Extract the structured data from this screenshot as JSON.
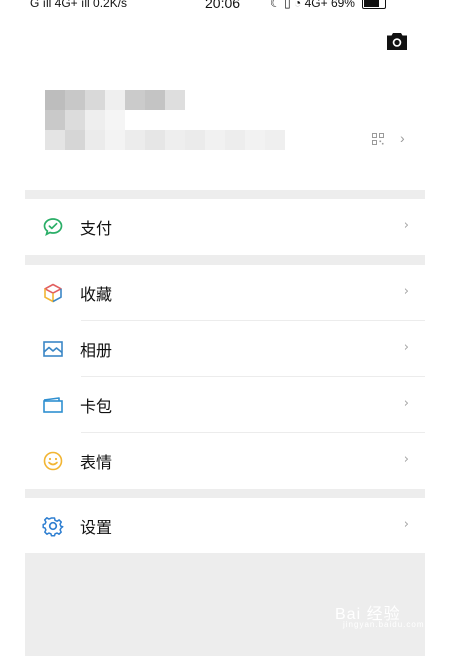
{
  "status_bar": {
    "left": "G ıll 4G+ ıll 0.2K/s",
    "time": "20:06",
    "right": "☾ ▯ ◔ 4G+ 69%"
  },
  "profile": {
    "chevron": "›"
  },
  "menu": {
    "pay": {
      "label": "支付",
      "icon": "wechat-pay-icon",
      "color": "#2aae67"
    },
    "groups": [
      [
        {
          "label": "收藏",
          "icon": "favorites-cube-icon"
        },
        {
          "label": "相册",
          "icon": "album-icon"
        },
        {
          "label": "卡包",
          "icon": "card-wallet-icon"
        },
        {
          "label": "表情",
          "icon": "sticker-smile-icon"
        }
      ]
    ],
    "settings": {
      "label": "设置",
      "icon": "settings-gear-icon"
    },
    "chevron": "›"
  },
  "watermark": {
    "text": "Bai 经验",
    "sub": "jingyan.baidu.com"
  },
  "colors": {
    "band": "#ededed",
    "chevron": "#a6a6a6",
    "pay_green": "#2aae67",
    "album_blue": "#3b87c6",
    "card_blue": "#2f8fd0",
    "sticker_yellow": "#f2b533",
    "settings_blue": "#2f7fd1"
  }
}
